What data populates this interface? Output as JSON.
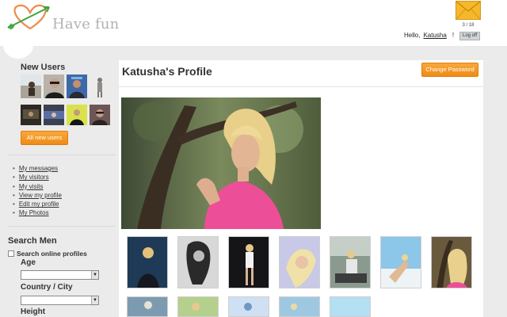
{
  "header": {
    "logo_text": "Have fun",
    "mail_icon": "envelope-icon",
    "mail_count": "3 / 18",
    "greeting": "Hello,",
    "username": "Katusha",
    "exclaim": "!",
    "logoff_label": "Log off"
  },
  "sidebar": {
    "new_users_title": "New Users",
    "all_new_users_label": "All new users",
    "menu": [
      {
        "label": "My messages"
      },
      {
        "label": "My visitors"
      },
      {
        "label": "My visits"
      },
      {
        "label": "View my profile"
      },
      {
        "label": "Edit my profile"
      },
      {
        "label": "My Photos"
      }
    ],
    "search": {
      "title": "Search Men",
      "online_label": "Search online profiles",
      "age_label": "Age",
      "age_value": "",
      "country_label": "Country / City",
      "country_value": "",
      "height_label": "Height"
    }
  },
  "profile": {
    "title": "Katusha's Profile",
    "change_password_label": "Change Password"
  },
  "colors": {
    "accent_orange": "#f29a27",
    "logo_green": "#3aa63a",
    "logo_orange": "#f08a4b",
    "mail_yellow": "#f5b82a"
  }
}
